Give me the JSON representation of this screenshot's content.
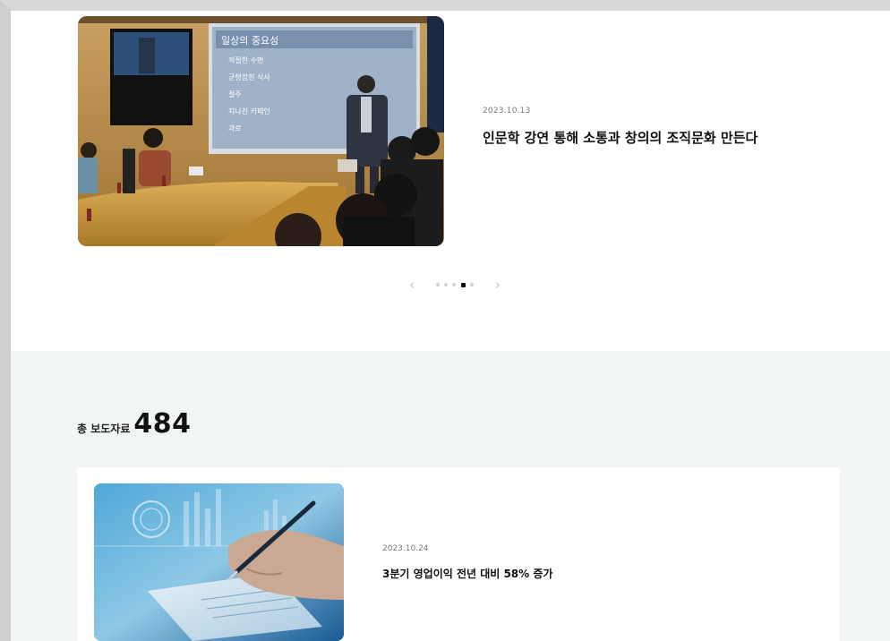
{
  "featured_slide": {
    "date": "2023.10.13",
    "title": "인문학 강연 통해 소통과 창의의 조직문화 만든다",
    "image_alt": "강연 사진",
    "screen_title": "일상의 중요성",
    "screen_bullets": [
      "적절한 수면",
      "균형잡힌 식사",
      "절주",
      "지나친 카페인",
      "과로"
    ]
  },
  "pager": {
    "prev_icon": "chevron-left-icon",
    "next_icon": "chevron-right-icon",
    "dot_count": 5,
    "active_index": 3
  },
  "press_section": {
    "total_label": "총 보도자료",
    "total_count": "484"
  },
  "press_list": [
    {
      "date": "2023.10.24",
      "title": "3분기 영업이익 전년 대비 58% 증가"
    }
  ],
  "colors": {
    "section_bg": "#f2f5f6",
    "active_dot": "#111111",
    "inactive_dot": "#d3d3d3"
  }
}
